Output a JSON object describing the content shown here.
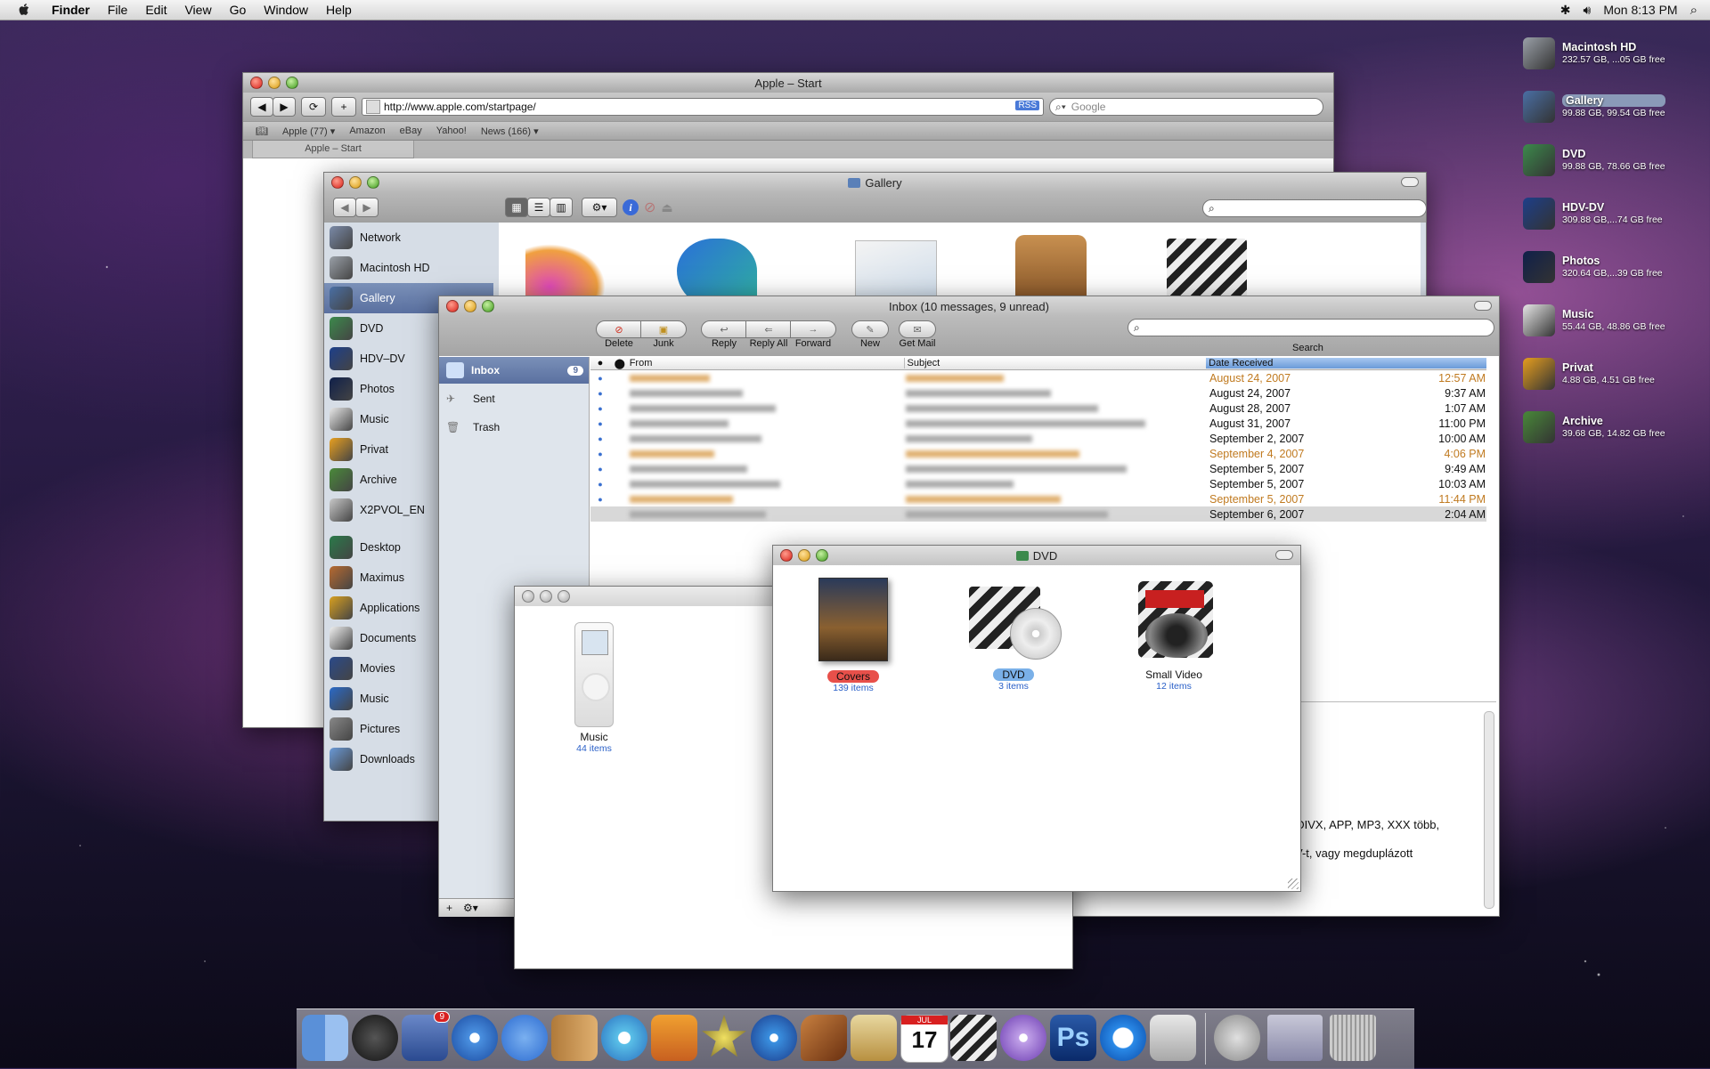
{
  "menubar": {
    "app": "Finder",
    "items": [
      "File",
      "Edit",
      "View",
      "Go",
      "Window",
      "Help"
    ],
    "clock": "Mon 8:13 PM"
  },
  "desktop_icons": [
    {
      "name": "Macintosh HD",
      "info": "232.57 GB, ...05 GB free",
      "color": "#9aa0a8"
    },
    {
      "name": "Gallery",
      "info": "99.88 GB, 99.54 GB free",
      "color": "#4a6fa5"
    },
    {
      "name": "DVD",
      "info": "99.88 GB, 78.66 GB free",
      "color": "#3c8a4c"
    },
    {
      "name": "HDV-DV",
      "info": "309.88 GB,...74 GB free",
      "color": "#1d3f8a"
    },
    {
      "name": "Photos",
      "info": "320.64 GB,...39 GB free",
      "color": "#10204a"
    },
    {
      "name": "Music",
      "info": "55.44 GB, 48.86 GB free",
      "color": "#e8e8e8"
    },
    {
      "name": "Privat",
      "info": "4.88 GB, 4.51 GB free",
      "color": "#e8a020"
    },
    {
      "name": "Archive",
      "info": "39.68 GB, 14.82 GB free",
      "color": "#4a8a3a"
    }
  ],
  "safari": {
    "title": "Apple – Start",
    "url": "http://www.apple.com/startpage/",
    "rss": "RSS",
    "search_placeholder": "Google",
    "bookmarks": [
      "Apple (77) ▾",
      "Amazon",
      "eBay",
      "Yahoo!",
      "News (166) ▾"
    ],
    "tab": "Apple – Start"
  },
  "gallery": {
    "title": "Gallery",
    "sidebar_devices": [
      {
        "label": "Network",
        "color": "#7a8aa8"
      },
      {
        "label": "Macintosh HD",
        "color": "#9aa0a8"
      },
      {
        "label": "Gallery",
        "color": "#4a6fa5"
      },
      {
        "label": "DVD",
        "color": "#3c8a4c"
      },
      {
        "label": "HDV–DV",
        "color": "#1d3f8a"
      },
      {
        "label": "Photos",
        "color": "#10204a"
      },
      {
        "label": "Music",
        "color": "#e8e8e8"
      },
      {
        "label": "Privat",
        "color": "#e8a020"
      },
      {
        "label": "Archive",
        "color": "#4a8a3a"
      },
      {
        "label": "X2PVOL_EN",
        "color": "#c8c8c8"
      }
    ],
    "sidebar_places": [
      {
        "label": "Desktop",
        "color": "#2a7a4a"
      },
      {
        "label": "Maximus",
        "color": "#b86a30"
      },
      {
        "label": "Applications",
        "color": "#d8a020"
      },
      {
        "label": "Documents",
        "color": "#f0f0f0"
      },
      {
        "label": "Movies",
        "color": "#2a4a8a"
      },
      {
        "label": "Music",
        "color": "#2a6ac8"
      },
      {
        "label": "Pictures",
        "color": "#888"
      },
      {
        "label": "Downloads",
        "color": "#6a9ad8"
      }
    ]
  },
  "mail": {
    "title": "Inbox (10 messages, 9 unread)",
    "toolbar": [
      "Delete",
      "Junk",
      "Reply",
      "Reply All",
      "Forward",
      "New",
      "Get Mail"
    ],
    "search_label": "Search",
    "mailboxes": [
      {
        "label": "Inbox",
        "badge": "9"
      },
      {
        "label": "Sent",
        "badge": ""
      },
      {
        "label": "Trash",
        "badge": ""
      }
    ],
    "columns": {
      "from": "From",
      "subject": "Subject",
      "date": "Date Received"
    },
    "rows": [
      {
        "date": "August 24, 2007",
        "time": "12:57 AM",
        "orange": true
      },
      {
        "date": "August 24, 2007",
        "time": "9:37 AM",
        "orange": false
      },
      {
        "date": "August 28, 2007",
        "time": "1:07 AM",
        "orange": false
      },
      {
        "date": "August 31, 2007",
        "time": "11:00 PM",
        "orange": false
      },
      {
        "date": "September 2, 2007",
        "time": "10:00 AM",
        "orange": false
      },
      {
        "date": "September 4, 2007",
        "time": "4:06 PM",
        "orange": true
      },
      {
        "date": "September 5, 2007",
        "time": "9:49 AM",
        "orange": false
      },
      {
        "date": "September 5, 2007",
        "time": "10:03 AM",
        "orange": false
      },
      {
        "date": "September 5, 2007",
        "time": "11:44 PM",
        "orange": true
      },
      {
        "date": "September 6, 2007",
        "time": "2:04 AM",
        "orange": false
      }
    ],
    "preview_line1": ", DIVX, APP, MP3, XXX több,",
    "preview_line2": "V-t, vagy megduplázott"
  },
  "music_window": {
    "item": {
      "name": "Music",
      "count": "44 items"
    }
  },
  "dvd_window": {
    "title": "DVD",
    "items": [
      {
        "name": "Covers",
        "count": "139 items",
        "label_color": "#e8504a"
      },
      {
        "name": "DVD",
        "count": "3 items",
        "label_color": "#7ab0e8"
      },
      {
        "name": "Small Video",
        "count": "12 items",
        "label_color": ""
      }
    ]
  },
  "dock": {
    "mail_badge": "9",
    "calendar_month": "JUL",
    "calendar_day": "17",
    "ps_label": "Ps"
  }
}
